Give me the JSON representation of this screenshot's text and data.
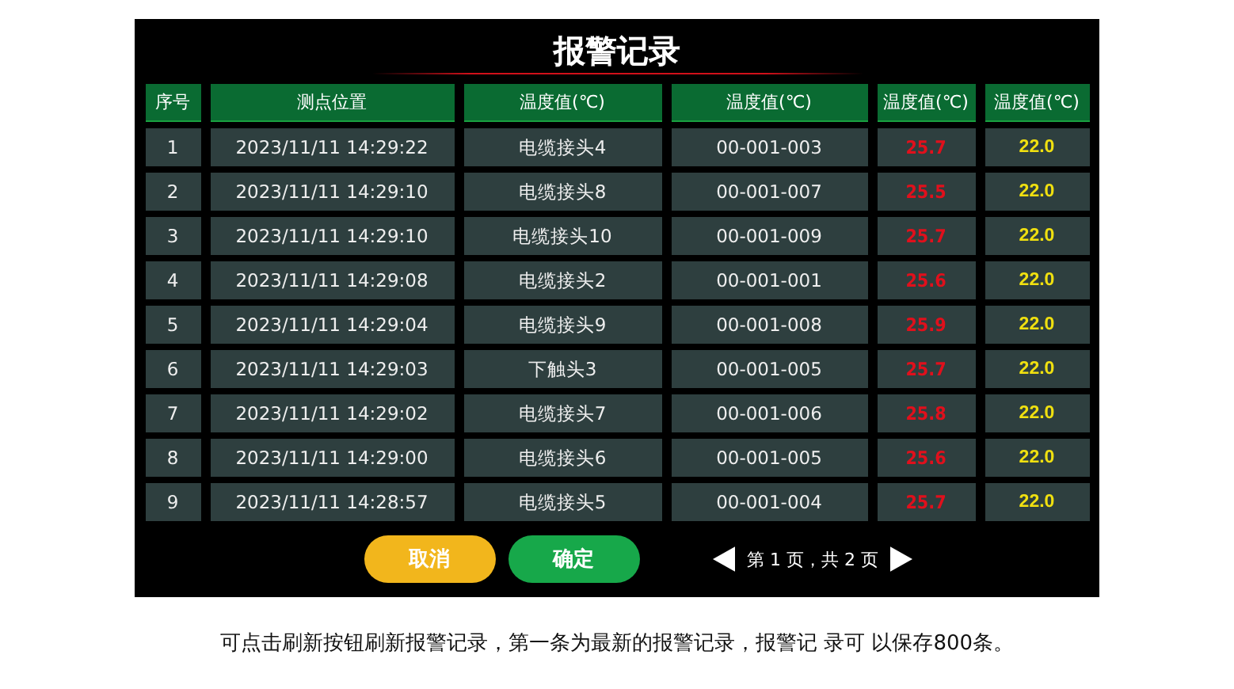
{
  "title": "报警记录",
  "table": {
    "columns": [
      "序号",
      "测点位置",
      "温度值(℃)",
      "温度值(℃)",
      "温度值(℃)",
      "温度值(℃)"
    ],
    "rows": [
      [
        "1",
        "2023/11/11 14:29:22",
        "电缆接头4",
        "00-001-003",
        "25.7",
        "22.0"
      ],
      [
        "2",
        "2023/11/11 14:29:10",
        "电缆接头8",
        "00-001-007",
        "25.5",
        "22.0"
      ],
      [
        "3",
        "2023/11/11 14:29:10",
        "电缆接头10",
        "00-001-009",
        "25.7",
        "22.0"
      ],
      [
        "4",
        "2023/11/11 14:29:08",
        "电缆接头2",
        "00-001-001",
        "25.6",
        "22.0"
      ],
      [
        "5",
        "2023/11/11 14:29:04",
        "电缆接头9",
        "00-001-008",
        "25.9",
        "22.0"
      ],
      [
        "6",
        "2023/11/11 14:29:03",
        "下触头3",
        "00-001-005",
        "25.7",
        "22.0"
      ],
      [
        "7",
        "2023/11/11 14:29:02",
        "电缆接头7",
        "00-001-006",
        "25.8",
        "22.0"
      ],
      [
        "8",
        "2023/11/11 14:29:00",
        "电缆接头6",
        "00-001-005",
        "25.6",
        "22.0"
      ],
      [
        "9",
        "2023/11/11 14:28:57",
        "电缆接头5",
        "00-001-004",
        "25.7",
        "22.0"
      ]
    ]
  },
  "buttons": [
    {
      "label": "取消",
      "kind": "cancel"
    },
    {
      "label": "确定",
      "kind": "confirm"
    }
  ],
  "pagination": "第 1 页，共 2 页",
  "caption": "可点击刷新按钮刷新报警记录，第一条为最新的报警记录，报警记 录可 以保存800条。"
}
